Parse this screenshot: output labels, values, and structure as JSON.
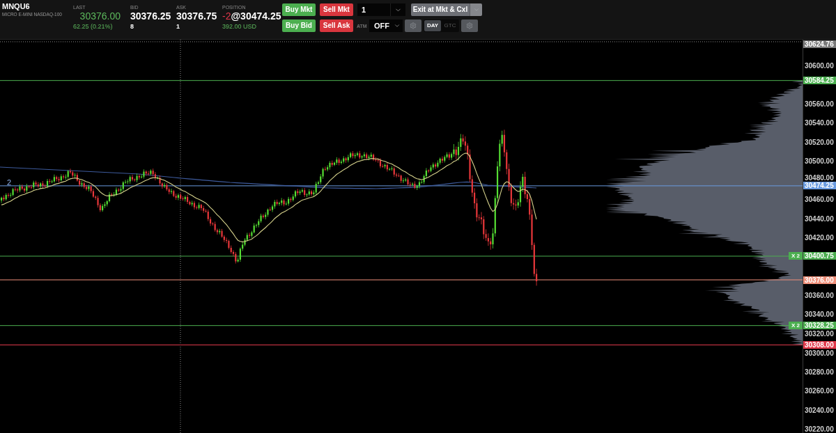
{
  "instrument": {
    "symbol": "MNQU6",
    "name": "MICRO E-MINI NASDAQ-100"
  },
  "quotes": [
    {
      "kind": "last",
      "label": "LAST",
      "value": "30376.00",
      "detail": "62.25 (0.21%)"
    },
    {
      "kind": "plain",
      "label": "BID",
      "value": "30376.25",
      "detail": "8"
    },
    {
      "kind": "plain",
      "label": "ASK",
      "value": "30376.75",
      "detail": "1"
    }
  ],
  "position": {
    "label": "POSITION",
    "quantity": "-2",
    "price": "@30474.25",
    "pnl": "392.00 USD"
  },
  "order_panel": {
    "market_buttons": [
      {
        "label": "Buy Mkt",
        "kind": "buy"
      },
      {
        "label": "Sell Mkt",
        "kind": "sell"
      }
    ],
    "quantity": "1",
    "exit_button": "Exit at Mkt & Cxl",
    "limit_buttons": [
      {
        "label": "Buy Bid",
        "kind": "buy"
      },
      {
        "label": "Sell Ask",
        "kind": "sell"
      }
    ],
    "atm": {
      "label": "ATM",
      "value": "OFF"
    },
    "time_in_force": [
      {
        "label": "DAY",
        "selected": true
      },
      {
        "label": "GTC",
        "selected": false
      }
    ]
  },
  "chart": {
    "position_marker": "2",
    "crosshair": {
      "price": "30624.76"
    },
    "price_levels": [
      {
        "price": "30584.25",
        "color": "#4caf50"
      },
      {
        "price": "30474.25",
        "color": "#6a9be0"
      },
      {
        "price": "30400.75",
        "color": "#4caf50",
        "tag": "X 2"
      },
      {
        "price": "30376.00",
        "color": "#f0907a"
      },
      {
        "price": "30328.25",
        "color": "#4caf50",
        "tag": "X 2"
      },
      {
        "price": "30308.00",
        "color": "#e0384a"
      }
    ],
    "price_axis": [
      "30600.00",
      "30560.00",
      "30540.00",
      "30520.00",
      "30500.00",
      "30480.00",
      "30460.00",
      "30440.00",
      "30420.00",
      "30360.00",
      "30340.00",
      "30320.00",
      "30300.00",
      "30280.00",
      "30260.00",
      "30240.00",
      "30220.00"
    ]
  }
}
